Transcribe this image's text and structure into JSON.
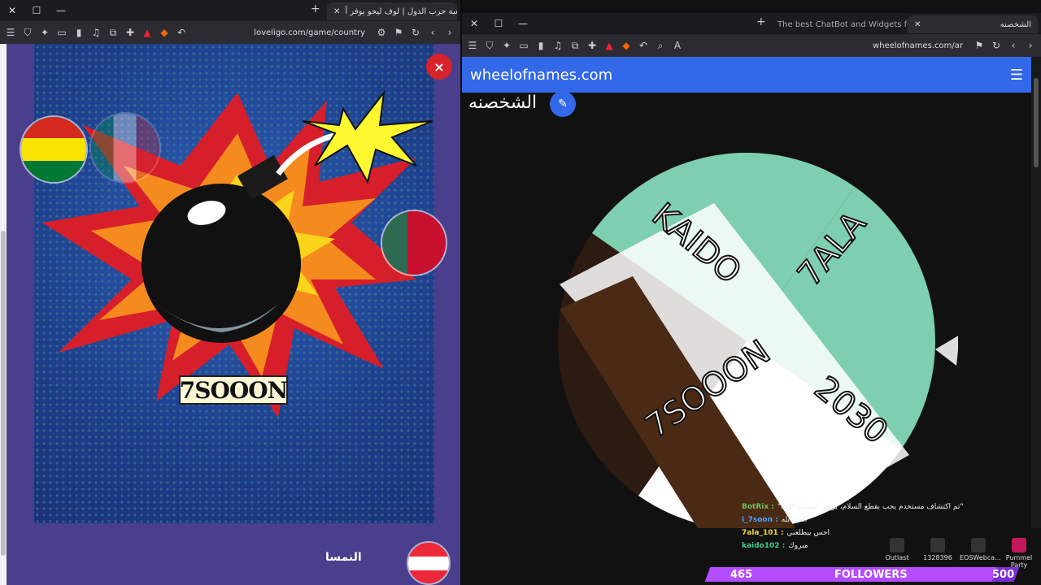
{
  "left": {
    "tab_title": "لعبة حرب الدول | لوف ليجو يوفر أ...",
    "url": "loveligo.com/game/country",
    "player_name": "7SOOON",
    "country_name": "النمسا",
    "close_label": "×"
  },
  "right": {
    "tab_title": "الشخصنه",
    "tab2_title": "The best ChatBot and Widgets for Ki...",
    "url": "wheelofnames.com/ar",
    "site_name": "wheelofnames.com",
    "wheel_title": "الشخصنه",
    "wheel": {
      "entries": [
        "7ALA",
        "KAIDO",
        "7SOOON",
        "2030"
      ],
      "colors": [
        "#7ecfb0",
        "#ffffff",
        "#2b1b10",
        "#7ecfb0"
      ]
    }
  },
  "overlay": {
    "chat": [
      {
        "user": "BotRix :",
        "msg": "\"تم اكتشاف مستخدم يحب بقطع السلام، يرجى انضمام كلمه\"",
        "color": "#6fbf5a"
      },
      {
        "user": "i_7soon :",
        "msg": "الحمدلله",
        "color": "#4aa3ff"
      },
      {
        "user": "7ala_101 :",
        "msg": "احس بيطلعني",
        "color": "#f5d742"
      },
      {
        "user": "kaido102 :",
        "msg": "مبروك",
        "color": "#3ecf8e"
      }
    ],
    "taskbar": [
      {
        "label": "Outlast"
      },
      {
        "label": "1328396"
      },
      {
        "label": "EOSWebca..."
      },
      {
        "label": "Pummel Party"
      }
    ],
    "followers": {
      "current": "465",
      "label": "FOLLOWERS",
      "goal": "500",
      "progress": 0.93
    }
  },
  "colors": {
    "accent": "#3369e8",
    "close_red": "#d8232a",
    "followers_purple": "#7b2fd0"
  }
}
